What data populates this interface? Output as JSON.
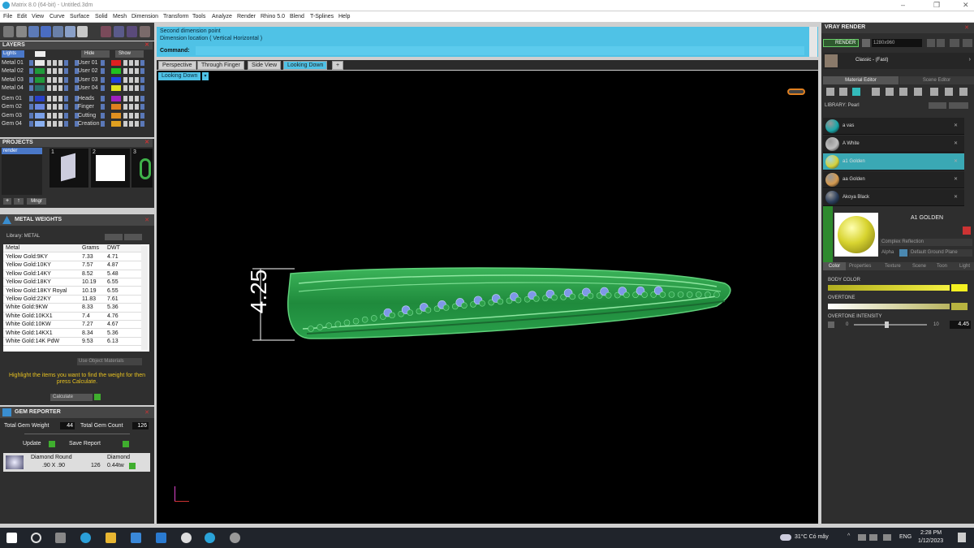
{
  "window": {
    "title": "Matrix 8.0 (64-bit) - Untitled.3dm"
  },
  "menu": [
    "File",
    "Edit",
    "View",
    "Curve",
    "Surface",
    "Solid",
    "Mesh",
    "Dimension",
    "Transform",
    "Tools",
    "Analyze",
    "Render",
    "Rhino 5.0",
    "Blend",
    "T-Splines",
    "Help"
  ],
  "layers": {
    "title": "LAYERS",
    "lights_label": "Lights",
    "hide_label": "Hide",
    "show_label": "Show",
    "left": [
      "Metal 01",
      "Metal 02",
      "Metal 03",
      "Metal 04",
      "Gem 01",
      "Gem 02",
      "Gem 03",
      "Gem 04"
    ],
    "right": [
      "User 01",
      "User 02",
      "User 03",
      "User 04",
      "Heads",
      "Finger",
      "Cutting",
      "Creation"
    ],
    "left_colors": [
      "#e8e8e8",
      "#1f9a3a",
      "#1f9a3a",
      "#2a6e6a",
      "#2840c8",
      "#6a88e0",
      "#7aa0e8",
      "#8ab0f0"
    ],
    "right_colors": [
      "#e02020",
      "#20c020",
      "#2040e0",
      "#e0e020",
      "#a020c0",
      "#e08020",
      "#e09020",
      "#e0a020"
    ]
  },
  "projects": {
    "title": "PROJECTS",
    "item": "render",
    "thumbs": [
      "1",
      "2",
      "3"
    ],
    "mngr": "Mngr"
  },
  "metal_weights": {
    "title": "METAL WEIGHTS",
    "library": "Library: METAL",
    "headers": [
      "Metal",
      "Grams",
      "DWT"
    ],
    "rows": [
      [
        "Yellow Gold:9KY",
        "7.33",
        "4.71"
      ],
      [
        "Yellow Gold:10KY",
        "7.57",
        "4.87"
      ],
      [
        "Yellow Gold:14KY",
        "8.52",
        "5.48"
      ],
      [
        "Yellow Gold:18KY",
        "10.19",
        "6.55"
      ],
      [
        "Yellow Gold:18KY Royal",
        "10.19",
        "6.55"
      ],
      [
        "Yellow Gold:22KY",
        "11.83",
        "7.61"
      ],
      [
        "White Gold:9KW",
        "8.33",
        "5.36"
      ],
      [
        "White Gold:10KX1",
        "7.4",
        "4.76"
      ],
      [
        "White Gold:10KW",
        "7.27",
        "4.67"
      ],
      [
        "White Gold:14KX1",
        "8.34",
        "5.36"
      ],
      [
        "White Gold:14K PdW",
        "9.53",
        "6.13"
      ]
    ],
    "use_object": "Use Object Materials",
    "hint": "Highlight the items you want to find the weight for then press Calculate.",
    "calculate": "Calculate"
  },
  "gem_reporter": {
    "title": "GEM REPORTER",
    "total_weight_label": "Total Gem Weight",
    "total_weight": "44",
    "total_count_label": "Total Gem Count",
    "total_count": "126",
    "update": "Update",
    "save_report": "Save Report",
    "gem_shape": "Diamond Round",
    "gem_type": "Diamond",
    "gem_size": ".90 X .90",
    "gem_count": "126",
    "gem_ctw": "0.44tw"
  },
  "command": {
    "line1": "Second dimension point",
    "line2": "Dimension location ( Vertical  Horizontal )",
    "prompt": "Command:"
  },
  "view_tabs": [
    "Perspective",
    "Through Finger",
    "Side View",
    "Looking Down"
  ],
  "active_view": "Looking Down",
  "dimension_value": "4.25",
  "vray": {
    "title": "VRAY RENDER",
    "render_button": "RENDER",
    "resolution": "1280x960",
    "style_label": "Classic - (Fast)",
    "tabs": [
      "Material Editor",
      "Scene Editor"
    ],
    "library": "LIBRARY: Pearl",
    "materials": [
      {
        "name": "a vas",
        "color": "#1aa6a8"
      },
      {
        "name": "A White",
        "color": "#bfbfbf"
      },
      {
        "name": "a1 Golden",
        "color": "#d6d23a"
      },
      {
        "name": "aa Golden",
        "color": "#d49a50"
      },
      {
        "name": "Akoya Black",
        "color": "#2a3d5a"
      }
    ],
    "selected_material": "A1 GOLDEN",
    "shader": "Complex Reflection",
    "alpha_label": "Alpha",
    "ground_plane": "Default Ground Plane",
    "sub_tabs": [
      "Color",
      "Properties",
      "Texture",
      "Scene",
      "Toon",
      "Light"
    ],
    "body_color_label": "BODY COLOR",
    "overtone_label": "OVERTONE",
    "overtone_intensity_label": "OVERTONE INTENSITY",
    "intensity_min": "0",
    "intensity_max": "10",
    "intensity_value": "4.45"
  },
  "taskbar": {
    "weather": "31°C  Có mây",
    "lang": "ENG",
    "time": "2:28 PM",
    "date": "1/12/2023"
  }
}
